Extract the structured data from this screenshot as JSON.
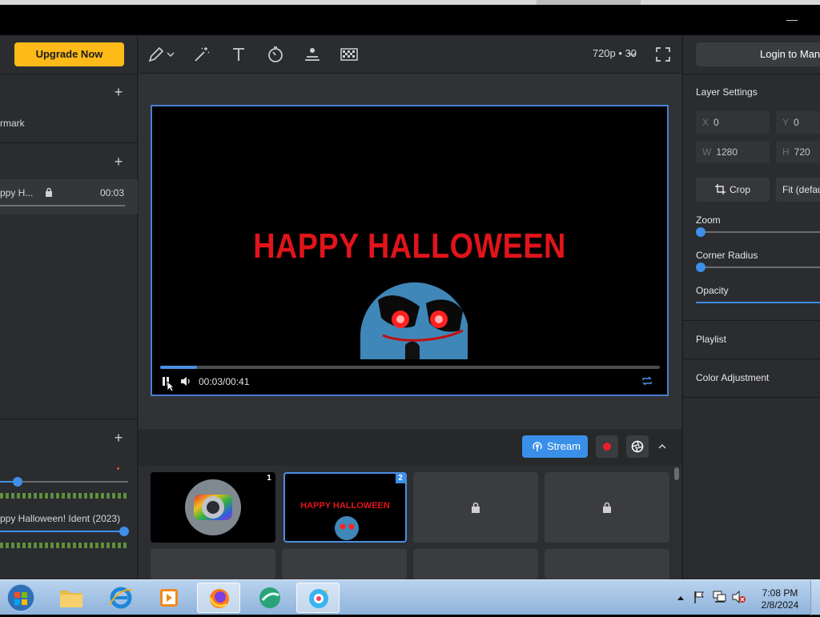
{
  "header": {
    "minimize_glyph": "—"
  },
  "left": {
    "upgrade_label": "Upgrade Now",
    "watermark_label": "rmark",
    "media_item": {
      "name": "ppy H...",
      "duration": "00:03"
    },
    "audio_item_label": "ppy Halloween! Ident (2023)"
  },
  "toolbar": {
    "resolution": "720p • 30"
  },
  "preview": {
    "title_text": "HAPPY HALLOWEEN",
    "time": "00:03/00:41",
    "progress": 0.073
  },
  "controls": {
    "stream_label": "Stream"
  },
  "scenes": [
    {
      "number": "1",
      "locked": false
    },
    {
      "number": "2",
      "locked": false,
      "thumb_text": "HAPPY HALLOWEEN"
    },
    {
      "locked": true
    },
    {
      "locked": true
    }
  ],
  "right": {
    "login_label": "Login to Man",
    "layer_settings_label": "Layer Settings",
    "x": {
      "key": "X",
      "value": "0"
    },
    "y": {
      "key": "Y",
      "value": "0"
    },
    "w": {
      "key": "W",
      "value": "1280"
    },
    "h": {
      "key": "H",
      "value": "720"
    },
    "crop_label": "Crop",
    "fit_label": "Fit (defau",
    "zoom_label": "Zoom",
    "corner_radius_label": "Corner Radius",
    "opacity_label": "Opacity",
    "playlist_label": "Playlist",
    "color_adjustment_label": "Color Adjustment"
  },
  "taskbar": {
    "time": "7:08 PM",
    "date": "2/8/2024"
  },
  "colors": {
    "accent": "#3a8fe8",
    "upgrade": "#fdba18",
    "halloween_red": "#e0141a"
  }
}
